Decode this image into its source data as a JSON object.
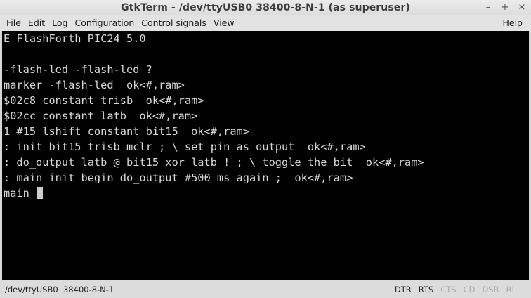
{
  "window": {
    "title": "GtkTerm - /dev/ttyUSB0  38400-8-N-1 (as superuser)",
    "controls": {
      "minimize": "–",
      "maximize": "+",
      "close": "×"
    }
  },
  "menu": [
    {
      "mn": "F",
      "rest": "ile"
    },
    {
      "mn": "E",
      "rest": "dit"
    },
    {
      "mn": "L",
      "rest": "og"
    },
    {
      "mn": "C",
      "rest": "onfiguration"
    },
    {
      "mn": "",
      "rest": "Control signals"
    },
    {
      "mn": "V",
      "rest": "iew"
    }
  ],
  "help": {
    "mn": "H",
    "rest": "elp"
  },
  "terminal": {
    "lines": [
      "E FlashForth PIC24 5.0",
      "",
      "-flash-led -flash-led ?",
      "marker -flash-led  ok<#,ram>",
      "$02c8 constant trisb  ok<#,ram>",
      "$02cc constant latb  ok<#,ram>",
      "1 #15 lshift constant bit15  ok<#,ram>",
      ": init bit15 trisb mclr ; \\ set pin as output  ok<#,ram>",
      ": do_output latb @ bit15 xor latb ! ; \\ toggle the bit  ok<#,ram>",
      ": main init begin do_output #500 ms again ;  ok<#,ram>",
      "main "
    ]
  },
  "status": {
    "port": "/dev/ttyUSB0  38400-8-N-1",
    "signals": {
      "dtr": "DTR",
      "rts": "RTS",
      "cts": "CTS",
      "cd": "CD",
      "dsr": "DSR",
      "ri": "RI"
    }
  },
  "colors": {
    "terminal_bg": "#000000",
    "terminal_fg": "#d8d8d8",
    "signal_active": "#222222",
    "signal_inactive": "#a9a9a9"
  }
}
